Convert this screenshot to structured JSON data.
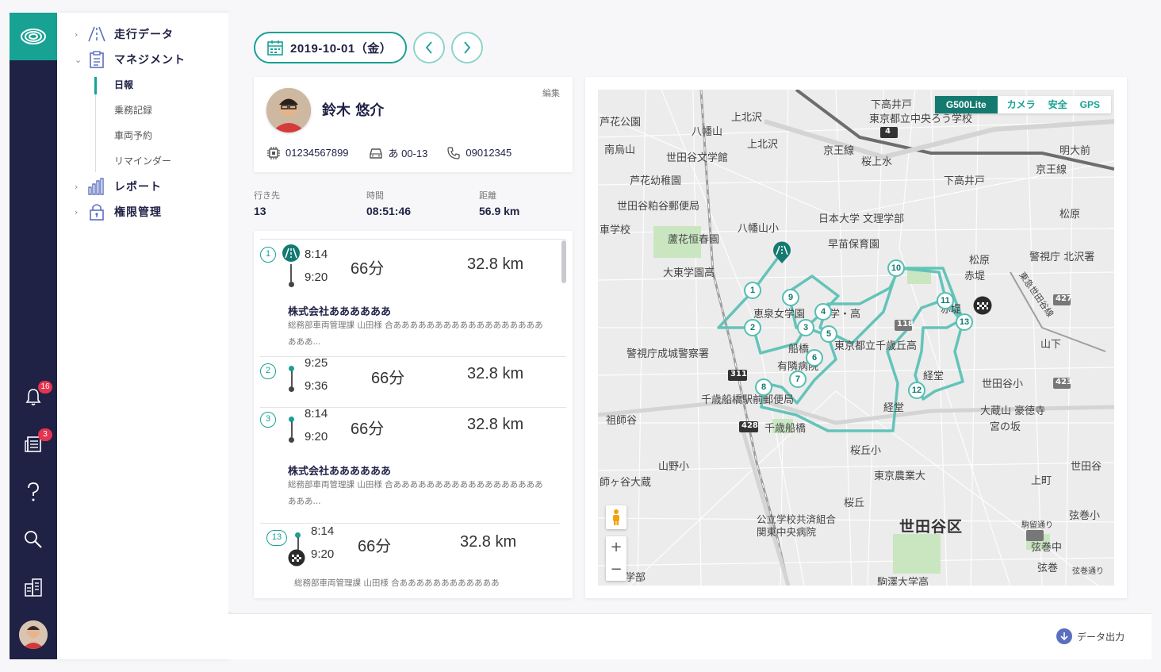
{
  "sidebar": {
    "groups": [
      {
        "label": "走行データ",
        "icon": "road-icon"
      },
      {
        "label": "マネジメント",
        "icon": "clipboard-icon"
      },
      {
        "label": "レポート",
        "icon": "bar-chart-icon"
      },
      {
        "label": "権限管理",
        "icon": "lock-icon"
      }
    ],
    "sub_items": [
      "日報",
      "乗務記録",
      "車両予約",
      "リマインダー"
    ],
    "active_sub": "日報"
  },
  "rail": {
    "notifications_count": "16",
    "news_count": "3",
    "icons": [
      "bell-icon",
      "newspaper-icon",
      "help-icon",
      "search-icon",
      "building-icon"
    ]
  },
  "date": {
    "label": "2019-10-01（金）"
  },
  "driver": {
    "name": "鈴木 悠介",
    "edit_label": "編集",
    "device_id": "01234567899",
    "vehicle": "あ 00-13",
    "phone": "09012345"
  },
  "stats": [
    {
      "label": "行き先",
      "value": "13"
    },
    {
      "label": "時間",
      "value": "08:51:46"
    },
    {
      "label": "距離",
      "value": "56.9 km"
    }
  ],
  "trips": [
    {
      "num": "1",
      "start": "8:14",
      "end": "9:20",
      "duration": "66分",
      "distance": "32.8 km",
      "company": "株式会社ああああああ",
      "detail": "総務部車両管理課 山田様 合あああああああああああああああああああああ..."
    },
    {
      "num": "2",
      "start": "9:25",
      "end": "9:36",
      "duration": "66分",
      "distance": "32.8 km"
    },
    {
      "num": "3",
      "start": "8:14",
      "end": "9:20",
      "duration": "66分",
      "distance": "32.8 km",
      "company": "株式会社ああああああ",
      "detail": "総務部車両管理課 山田様 合あああああああああああああああああああああ..."
    },
    {
      "num": "13",
      "start": "8:14",
      "end": "9:20",
      "duration": "66分",
      "distance": "32.8 km",
      "detail": "総務部車両管理課 山田様 合ああああああああああああ"
    }
  ],
  "map": {
    "tabs": [
      "G500Lite",
      "カメラ",
      "安全",
      "GPS"
    ],
    "active_tab": "G500Lite",
    "labels": [
      "芦花公園",
      "八幡山",
      "上北沢",
      "南烏山",
      "世田谷文学館",
      "上北沢",
      "京王線",
      "桜上水",
      "下高井戸",
      "東京都立中央ろう学校",
      "明大前",
      "京王線",
      "芦花幼稚園",
      "下高井戸",
      "世田谷粕谷郵便局",
      "日本大学 文理学部",
      "松原",
      "車学校",
      "蘆花恒春園",
      "八幡山小",
      "早苗保育園",
      "大東学園高",
      "松原",
      "警視庁 北沢署",
      "赤堤",
      "東急世田谷線",
      "恵泉女学園",
      "学・高",
      "赤堤",
      "船橋",
      "東京都立千歳丘高",
      "山下",
      "有隣病院",
      "警視庁成城警察署",
      "千歳船橋駅前郵便局",
      "経堂",
      "世田谷小",
      "祖師谷",
      "千歳船橋",
      "経堂",
      "大蔵山 豪徳寺",
      "宮の坂",
      "桜丘小",
      "山野小",
      "東京農業大",
      "世田谷",
      "師ヶ谷大蔵",
      "桜丘",
      "上町",
      "世田谷区",
      "公立学校共済組合 関東中央病院",
      "弦巻小",
      "駒留通り",
      "弦巻中",
      "弦巻",
      "駒澤大学高",
      "弦巻通り",
      "学部"
    ],
    "route_markers": [
      "1",
      "2",
      "3",
      "4",
      "5",
      "6",
      "7",
      "8",
      "9",
      "10",
      "11",
      "12",
      "13"
    ],
    "road_shields": [
      "4",
      "311",
      "428",
      "118",
      "427",
      "423"
    ]
  },
  "footer": {
    "export_label": "データ出力"
  }
}
